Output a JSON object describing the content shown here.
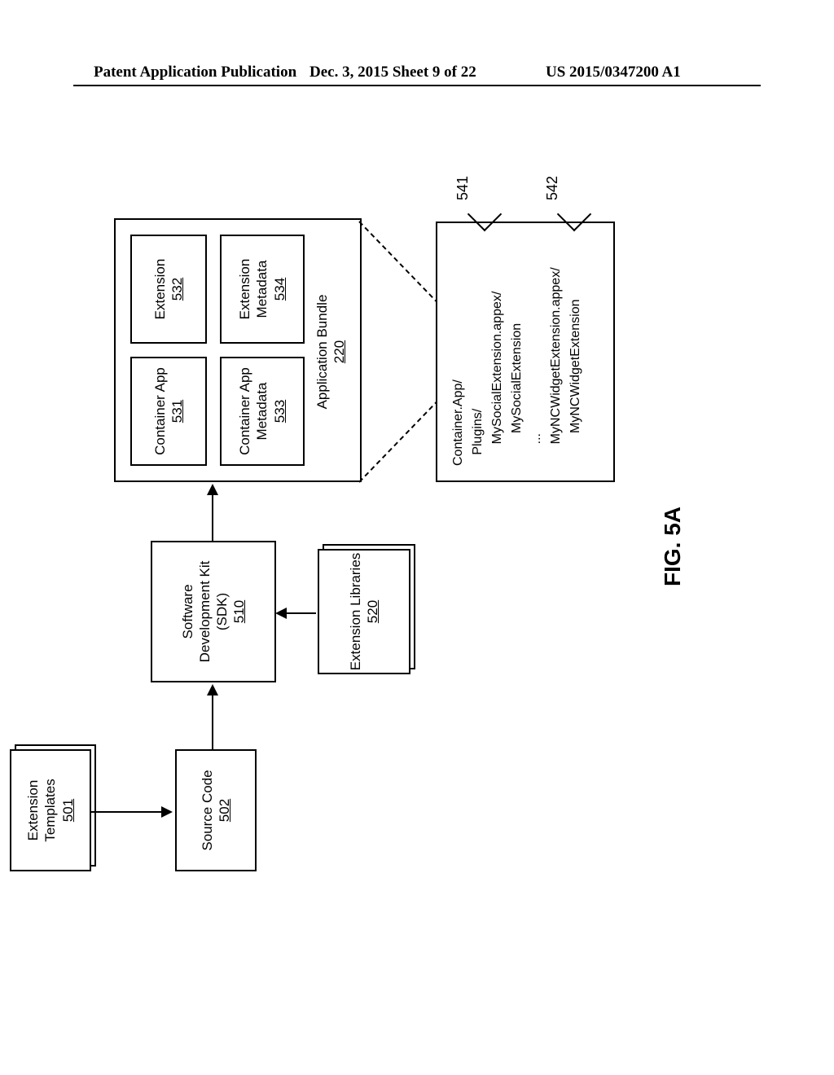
{
  "header": {
    "left": "Patent Application Publication",
    "middle": "Dec. 3, 2015  Sheet 9 of 22",
    "right": "US 2015/0347200 A1"
  },
  "figure_caption": "FIG. 5A",
  "blocks": {
    "ext_templates": {
      "title": "Extension Templates",
      "ref": "501"
    },
    "source_code": {
      "title": "Source Code",
      "ref": "502"
    },
    "sdk": {
      "title": "Software Development Kit (SDK)",
      "ref": "510"
    },
    "ext_libs": {
      "title": "Extension Libraries",
      "ref": "520"
    },
    "bundle": {
      "title": "Application Bundle",
      "ref": "220"
    },
    "container_app": {
      "title": "Container App",
      "ref": "531"
    },
    "extension": {
      "title": "Extension",
      "ref": "532"
    },
    "container_meta": {
      "title": "Container App Metadata",
      "ref": "533"
    },
    "ext_meta": {
      "title": "Extension Metadata",
      "ref": "534"
    }
  },
  "paths_block": {
    "lines": "Container.App/\n   Plugins/\n      MySocialExtension.appex/\n         MySocialExtension\n      ...\n      MyNCWidgetExtension.appex/\n         MyNCWidgetExtension"
  },
  "refs": {
    "r541": "541",
    "r542": "542"
  }
}
